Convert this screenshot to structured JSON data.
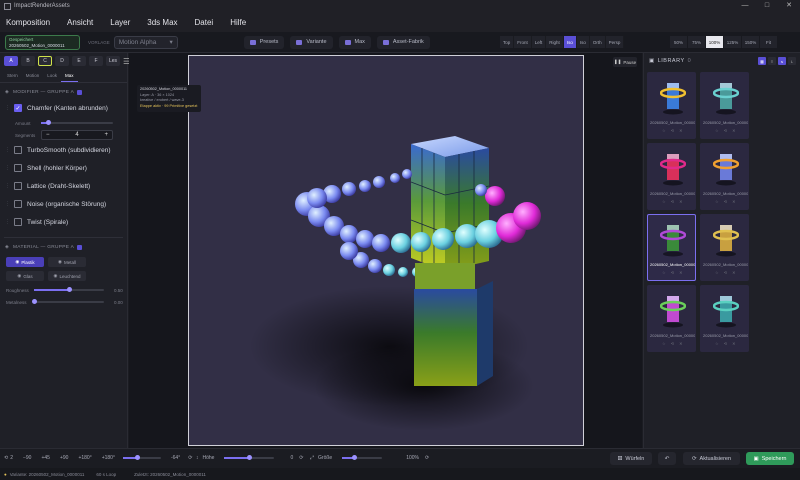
{
  "window": {
    "title": "ImpactRenderAssets",
    "controls": [
      "—",
      "□",
      "✕"
    ]
  },
  "menu": [
    "Komposition",
    "Ansicht",
    "Layer",
    "3ds Max",
    "Datei",
    "Hilfe"
  ],
  "toolbar": {
    "project_status": "Gespeichert",
    "project_name": "20260502_Motion_0000011",
    "preset_label": "VORLAGE",
    "preset_value": "Motion Alpha",
    "tools": [
      "Presets",
      "Variante",
      "Max",
      "Asset-Fabrik"
    ],
    "views": [
      {
        "label": "Top",
        "on": false
      },
      {
        "label": "Front",
        "on": false
      },
      {
        "label": "Left",
        "on": false
      },
      {
        "label": "Right",
        "on": false
      },
      {
        "label": "Iso",
        "on": true
      },
      {
        "label": "Iso",
        "on": false
      },
      {
        "label": "Orth",
        "on": false
      },
      {
        "label": "Persp",
        "on": false
      }
    ],
    "zoom": [
      {
        "label": "50%",
        "on": false
      },
      {
        "label": "75%",
        "on": false
      },
      {
        "label": "100%",
        "on": true
      },
      {
        "label": "125%",
        "on": false
      },
      {
        "label": "150%",
        "on": false
      },
      {
        "label": "Fit",
        "on": false
      }
    ]
  },
  "left": {
    "modes": [
      "A",
      "B",
      "C",
      "D",
      "E",
      "F",
      "Les"
    ],
    "tabs": [
      "Stern",
      "Motion",
      "Look",
      "Max"
    ],
    "modifier_head": "MODIFIER — GRUPPE A",
    "modifiers": [
      {
        "label": "Chamfer (Kanten abrunden)",
        "checked": true
      },
      {
        "label": "TurboSmooth (subdividieren)",
        "checked": false
      },
      {
        "label": "Shell (hohler Körper)",
        "checked": false
      },
      {
        "label": "Lattice (Draht-Skelett)",
        "checked": false
      },
      {
        "label": "Noise (organische Störung)",
        "checked": false
      },
      {
        "label": "Twist (Spirale)",
        "checked": false
      }
    ],
    "amount_label": "Amount",
    "amount": 0.1,
    "segments_label": "Segments",
    "segments": "4",
    "material_head": "MATERIAL — GRUPPE A",
    "materials": [
      {
        "label": "Plastik",
        "on": true
      },
      {
        "label": "Metall",
        "on": false
      },
      {
        "label": "Glas",
        "on": false
      },
      {
        "label": "Leuchtend",
        "on": false
      }
    ],
    "roughness_label": "Roughness",
    "roughness": 0.5,
    "roughness_text": "0.50",
    "metalness_label": "Metalness",
    "metalness": 0.0,
    "metalness_text": "0.00"
  },
  "viewport": {
    "info_title": "20260502_Motion_0000011",
    "info_line1": "Layer: A · 36 × 1024",
    "info_line2": "kreative / erobert / wave-3",
    "info_line3": "Etappe aktiv · 99 Primitive gesetzt",
    "pause_label": "Pause"
  },
  "library": {
    "title": "LIBRARY",
    "count": "0",
    "items": [
      {
        "name": "20260502_Motion_0000001",
        "hue": "#3a7ad8",
        "ring": "#f0c030",
        "sel": false
      },
      {
        "name": "20260502_Motion_0000002",
        "hue": "#4a9a9a",
        "ring": "#6ad0d0",
        "sel": false
      },
      {
        "name": "20260502_Motion_0000003",
        "hue": "#d8305a",
        "ring": "#e02a8a",
        "sel": false
      },
      {
        "name": "20260502_Motion_0000004",
        "hue": "#6a7ad8",
        "ring": "#f0a030",
        "sel": false
      },
      {
        "name": "20260502_Motion_0000011",
        "hue": "#3a8a3a",
        "ring": "#b04ad8",
        "sel": true
      },
      {
        "name": "20260502_Motion_0000005",
        "hue": "#c8a040",
        "ring": "#e0c050",
        "sel": false
      },
      {
        "name": "20260502_Motion_0000007",
        "hue": "#c04ad0",
        "ring": "#6ad05a",
        "sel": false
      },
      {
        "name": "20260502_Motion_0000008",
        "hue": "#3a9aa0",
        "ring": "#5ad0c0",
        "sel": false
      }
    ]
  },
  "bottom": {
    "steps": "2",
    "step_btns": [
      "−90",
      "+45",
      "+90",
      "+180°",
      "+180°"
    ],
    "angle": "-64°",
    "height_label": "Höhe",
    "height_value": "0",
    "size_label": "Größe",
    "size_value": "100%",
    "wuerfeln": "Würfeln",
    "aktualisieren": "Aktualisieren",
    "speichern": "Speichern"
  },
  "status": {
    "text1": "Variante: 20260502_Motion_0000011",
    "text2": "60 s Loop",
    "text3": "Zuletzt: 20260502_Motion_0000011"
  }
}
